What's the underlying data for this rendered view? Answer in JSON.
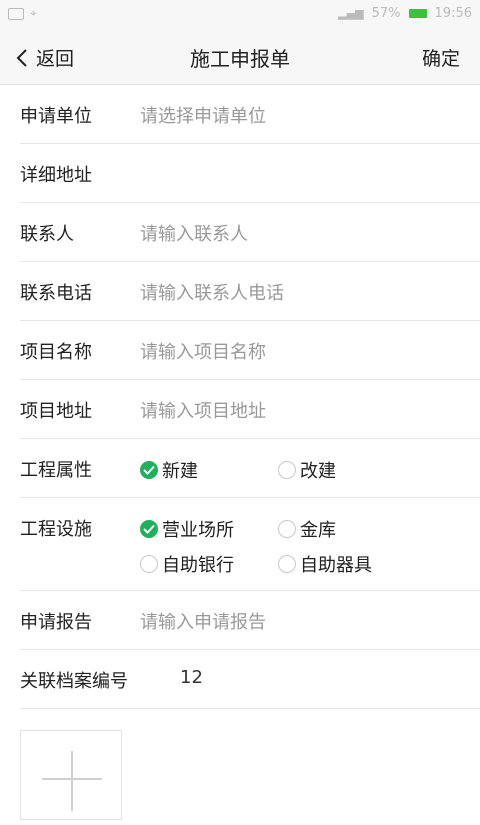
{
  "statusbar": {
    "battery": "57%",
    "time": "19:56"
  },
  "navbar": {
    "back_label": "返回",
    "title": "施工申报单",
    "confirm_label": "确定"
  },
  "form": {
    "applicant_unit": {
      "label": "申请单位",
      "placeholder": "请选择申请单位"
    },
    "address": {
      "label": "详细地址",
      "value": ""
    },
    "contact": {
      "label": "联系人",
      "placeholder": "请输入联系人"
    },
    "phone": {
      "label": "联系电话",
      "placeholder": "请输入联系人电话"
    },
    "project_name": {
      "label": "项目名称",
      "placeholder": "请输入项目名称"
    },
    "project_address": {
      "label": "项目地址",
      "placeholder": "请输入项目地址"
    },
    "project_attr": {
      "label": "工程属性",
      "options": [
        {
          "label": "新建",
          "checked": true
        },
        {
          "label": "改建",
          "checked": false
        }
      ]
    },
    "project_facility": {
      "label": "工程设施",
      "options": [
        {
          "label": "营业场所",
          "checked": true
        },
        {
          "label": "金库",
          "checked": false
        },
        {
          "label": "自助银行",
          "checked": false
        },
        {
          "label": "自助器具",
          "checked": false
        }
      ]
    },
    "report": {
      "label": "申请报告",
      "placeholder": "请输入申请报告"
    },
    "archive": {
      "label": "关联档案编号",
      "value": "12"
    }
  },
  "colors": {
    "accent": "#1fb05b",
    "bar_bg": "#f7f7f7",
    "divider": "#e6e6e6",
    "placeholder": "#999999"
  },
  "icons": {
    "back": "chevron-left-icon",
    "checked": "check-circle-icon",
    "unchecked": "empty-circle-icon",
    "add": "plus-icon"
  }
}
